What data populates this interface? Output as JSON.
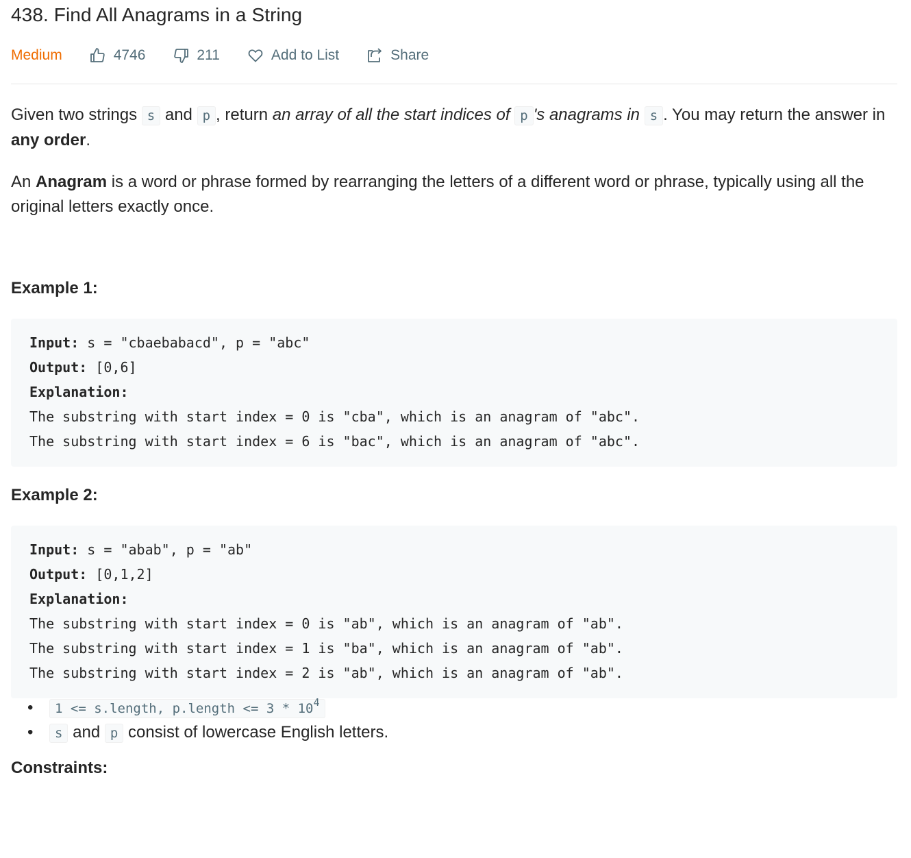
{
  "problem": {
    "title": "438. Find All Anagrams in a String",
    "difficulty": "Medium",
    "likes": "4746",
    "dislikes": "211",
    "add_to_list": "Add to List",
    "share": "Share"
  },
  "description": {
    "p1": {
      "t1": "Given two strings ",
      "c1": "s",
      "t2": " and ",
      "c2": "p",
      "t3": ", return ",
      "i1": "an array of all the start indices of ",
      "c3": "p",
      "i2": "'s anagrams in ",
      "c4": "s",
      "t4": ". You may return the answer in ",
      "b1": "any order",
      "t5": "."
    },
    "p2": {
      "t1": "An ",
      "b1": "Anagram",
      "t2": " is a word or phrase formed by rearranging the letters of a different word or phrase, typically using all the original letters exactly once."
    }
  },
  "examples": [
    {
      "title": "Example 1:",
      "input_label": "Input:",
      "input": " s = \"cbaebabacd\", p = \"abc\"",
      "output_label": "Output:",
      "output": " [0,6]",
      "explanation_label": "Explanation:",
      "lines": [
        "The substring with start index = 0 is \"cba\", which is an anagram of \"abc\".",
        "The substring with start index = 6 is \"bac\", which is an anagram of \"abc\"."
      ]
    },
    {
      "title": "Example 2:",
      "input_label": "Input:",
      "input": " s = \"abab\", p = \"ab\"",
      "output_label": "Output:",
      "output": " [0,1,2]",
      "explanation_label": "Explanation:",
      "lines": [
        "The substring with start index = 0 is \"ab\", which is an anagram of \"ab\".",
        "The substring with start index = 1 is \"ba\", which is an anagram of \"ab\".",
        "The substring with start index = 2 is \"ab\", which is an anagram of \"ab\"."
      ]
    }
  ],
  "constraints": {
    "title": "Constraints:",
    "c1_code": "1 <= s.length, p.length <= 3 * 10",
    "c1_sup": "4",
    "c2_code1": "s",
    "c2_text1": " and ",
    "c2_code2": "p",
    "c2_text2": " consist of lowercase English letters."
  },
  "colors": {
    "difficulty_medium": "#ef6c00",
    "meta_text": "#546e7a",
    "code_bg": "#f7f9fa"
  },
  "icons": [
    "thumbs-up-icon",
    "thumbs-down-icon",
    "heart-icon",
    "share-icon"
  ]
}
